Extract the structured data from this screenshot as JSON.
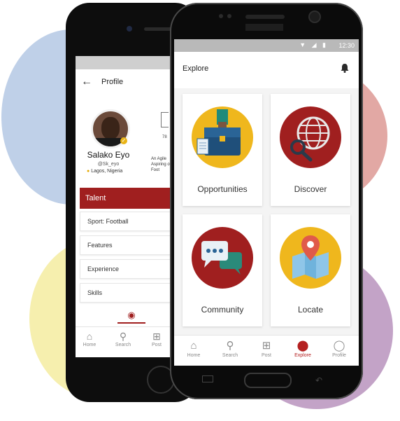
{
  "colors": {
    "accent": "#a01f1f",
    "active_nav": "#b42020",
    "yellow": "#efb71d",
    "dark_red": "#a01f1f"
  },
  "back_phone": {
    "header": {
      "back_icon": "arrow-left-icon",
      "title": "Profile"
    },
    "profile": {
      "name": "Salako Eyo",
      "handle": "@Sk_eyo",
      "location": "Lagos, Nigeria",
      "stat_partial": "78",
      "bio_partial": "An Agile Aspiring of Foot"
    },
    "talent_section": {
      "header": "Talent",
      "items": [
        "Sport: Football",
        "Features",
        "Experience",
        "Skills"
      ]
    },
    "camera_tab_icon": "camera-icon",
    "nav": [
      {
        "label": "Home",
        "icon": "home-icon"
      },
      {
        "label": "Search",
        "icon": "search-icon"
      },
      {
        "label": "Post",
        "icon": "plus-icon"
      }
    ]
  },
  "front_phone": {
    "status_bar": {
      "time": "12:30",
      "icons": "▼ ◢ ▮"
    },
    "header": {
      "title": "Explore",
      "bell_icon": "bell-icon"
    },
    "cards": [
      {
        "label": "Opportunities",
        "icon": "briefcase-icon",
        "circle_color": "#efb71d"
      },
      {
        "label": "Discover",
        "icon": "globe-search-icon",
        "circle_color": "#a01f1f"
      },
      {
        "label": "Community",
        "icon": "chat-bubbles-icon",
        "circle_color": "#a01f1f"
      },
      {
        "label": "Locate",
        "icon": "map-pin-icon",
        "circle_color": "#efb71d"
      }
    ],
    "nav": [
      {
        "label": "Home",
        "icon": "home-icon",
        "active": false
      },
      {
        "label": "Search",
        "icon": "search-icon",
        "active": false
      },
      {
        "label": "Post",
        "icon": "plus-icon",
        "active": false
      },
      {
        "label": "Explore",
        "icon": "explore-icon",
        "active": true
      },
      {
        "label": "Profile",
        "icon": "profile-icon",
        "active": false
      }
    ]
  }
}
